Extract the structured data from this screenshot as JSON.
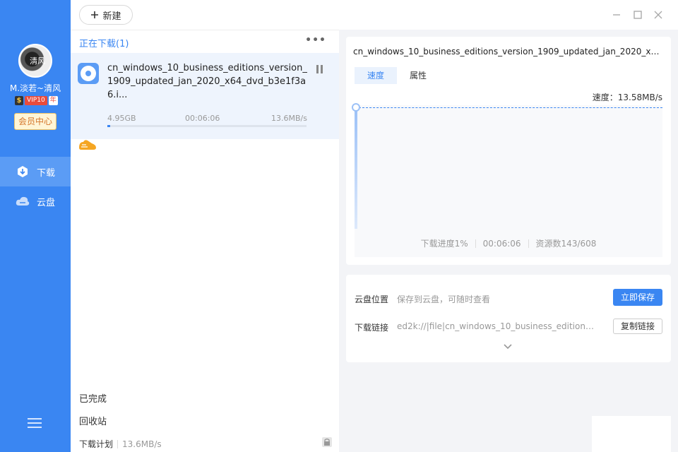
{
  "user": {
    "name": "M.淡若~清风",
    "avatar_text": "淸风",
    "vip_icon": "$",
    "vip_label": "VIP10",
    "vip_year": "年",
    "member_center": "会员中心"
  },
  "nav": [
    {
      "label": "下载",
      "icon": "download-icon",
      "active": true
    },
    {
      "label": "云盘",
      "icon": "cloud-icon",
      "active": false
    }
  ],
  "toolbar": {
    "new_label": "新建"
  },
  "list": {
    "header": "正在下载(1)",
    "more": "•••",
    "task": {
      "name": "cn_windows_10_business_editions_version_1909_updated_jan_2020_x64_dvd_b3e1f3a6.i...",
      "size": "4.95GB",
      "time": "00:06:06",
      "speed": "13.6MB/s",
      "progress": 0.01
    },
    "completed": "已完成",
    "recycle": "回收站",
    "plan": "下载计划",
    "plan_rate": "13.6MB/s"
  },
  "detail": {
    "title": "cn_windows_10_business_editions_version_1909_updated_jan_2020_x64_dvd...",
    "tabs": [
      "速度",
      "属性"
    ],
    "speed_label": "速度：13.58MB/s",
    "progress_text": "下载进度1%",
    "elapsed": "00:06:06",
    "resources": "资源数143/608"
  },
  "cloud": {
    "location_label": "云盘位置",
    "location_hint": "保存到云盘，可随时查看",
    "save_now": "立即保存",
    "link_label": "下载链接",
    "link_value": "ed2k://|file|cn_windows_10_business_editions...",
    "copy_link": "复制链接"
  },
  "colors": {
    "accent": "#3a86f2",
    "sidebar": "#3a86f2"
  }
}
